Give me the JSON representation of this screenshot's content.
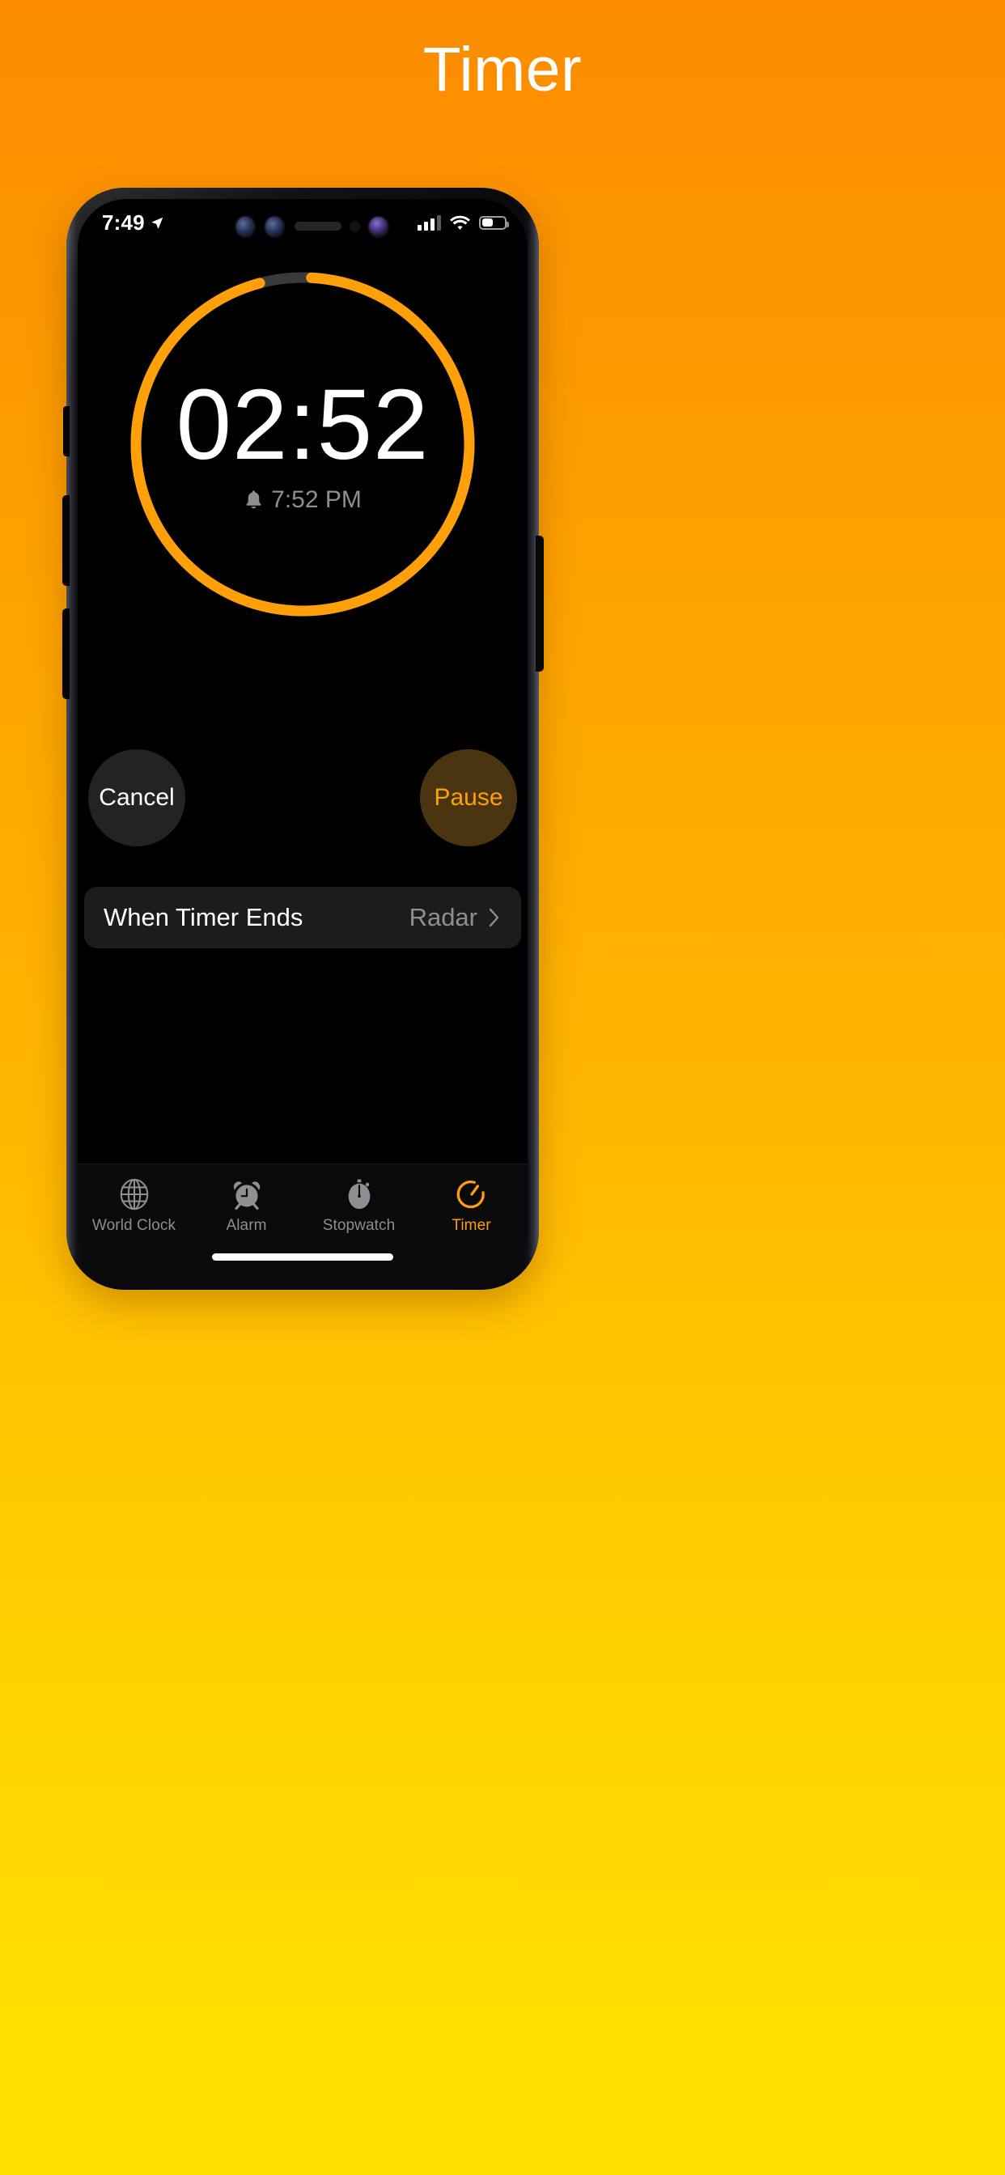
{
  "page": {
    "title": "Timer",
    "background_top_color": "#FB8C00",
    "background_bottom_color": "#FFE200",
    "accent_color": "#FF9F0A"
  },
  "status_bar": {
    "time": "7:49",
    "location_icon": "location-arrow-icon",
    "signal_icon": "cellular-signal-icon",
    "signal_bars_filled": 3,
    "signal_bars_total": 4,
    "wifi_icon": "wifi-icon",
    "battery_icon": "battery-icon",
    "battery_percent": 45
  },
  "notch": {
    "sensors": [
      "camera-sensor-icon",
      "camera-sensor-icon",
      "earpiece-speaker",
      "ambient-light-sensor",
      "front-camera-icon"
    ]
  },
  "timer": {
    "remaining": "02:52",
    "end_time": "7:52 PM",
    "bell_icon": "bell-icon",
    "ring": {
      "progress_percent": 95,
      "progress_color": "#FF9F0A",
      "track_color": "#3a3a3c",
      "gap_start_deg": -16,
      "gap_end_deg": 3
    }
  },
  "actions": {
    "cancel_label": "Cancel",
    "pause_label": "Pause"
  },
  "settings_row": {
    "label": "When Timer Ends",
    "value": "Radar",
    "chevron_icon": "chevron-right-icon"
  },
  "tab_bar": {
    "items": [
      {
        "label": "World Clock",
        "icon": "globe-icon",
        "active": false
      },
      {
        "label": "Alarm",
        "icon": "alarm-clock-icon",
        "active": false
      },
      {
        "label": "Stopwatch",
        "icon": "stopwatch-icon",
        "active": false
      },
      {
        "label": "Timer",
        "icon": "timer-icon",
        "active": true
      }
    ]
  },
  "home_indicator": "home-indicator"
}
